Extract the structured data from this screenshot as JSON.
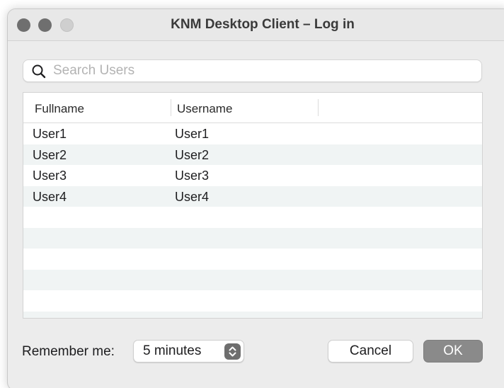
{
  "window": {
    "title": "KNM Desktop Client – Log in"
  },
  "search": {
    "placeholder": "Search Users",
    "value": ""
  },
  "table": {
    "columns": [
      "Fullname",
      "Username",
      ""
    ],
    "rows": [
      {
        "fullname": "User1",
        "username": "User1"
      },
      {
        "fullname": "User2",
        "username": "User2"
      },
      {
        "fullname": "User3",
        "username": "User3"
      },
      {
        "fullname": "User4",
        "username": "User4"
      }
    ]
  },
  "footer": {
    "remember_label": "Remember me:",
    "remember_value": "5 minutes",
    "cancel_label": "Cancel",
    "ok_label": "OK"
  },
  "colors": {
    "window_bg": "#ececec",
    "row_alt": "#f0f4f4",
    "ok_button": "#8a8a8a",
    "traffic_inactive": "#6f6f6f"
  },
  "icons": {
    "search": "magnifier-icon",
    "stepper": "up-down-chevron-icon"
  }
}
